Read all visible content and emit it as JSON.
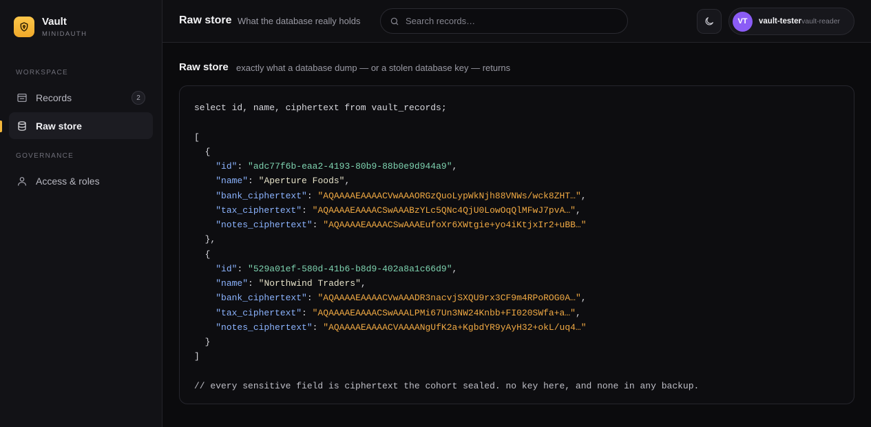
{
  "app": {
    "name": "Vault",
    "subtitle": "MINIDAUTH"
  },
  "sidebar": {
    "workspace_label": "WORKSPACE",
    "governance_label": "GOVERNANCE",
    "items": [
      {
        "label": "Records",
        "icon": "records-icon",
        "badge": "2"
      },
      {
        "label": "Raw store",
        "icon": "database-icon",
        "active": true
      },
      {
        "label": "Access & roles",
        "icon": "user-icon"
      }
    ]
  },
  "header": {
    "title": "Raw store",
    "subtitle": "What the database really holds",
    "search_placeholder": "Search records…",
    "user": {
      "initials": "VT",
      "name": "vault-tester",
      "role": "vault-reader"
    }
  },
  "content": {
    "title": "Raw store",
    "subtitle": "exactly what a database dump — or a stolen database key — returns",
    "query": "select id, name, ciphertext from vault_records;",
    "records": [
      {
        "id": "adc77f6b-eaa2-4193-80b9-88b0e9d944a9",
        "name": "Aperture Foods",
        "bank_ciphertext": "AQAAAAEAAAACVwAAAORGzQuoLypWkNjh88VNWs/wck8ZHT…",
        "tax_ciphertext": "AQAAAAEAAAACSwAAABzYLc5QNc4QjU0LowOqQlMFwJ7pvA…",
        "notes_ciphertext": "AQAAAAEAAAACSwAAAEufoXr6XWtgie+yo4iKtjxIr2+uBB…"
      },
      {
        "id": "529a01ef-580d-41b6-b8d9-402a8a1c66d9",
        "name": "Northwind Traders",
        "bank_ciphertext": "AQAAAAEAAAACVwAAADR3nacvjSXQU9rx3CF9m4RPoROG0A…",
        "tax_ciphertext": "AQAAAAEAAAACSwAAALPMi67Un3NW24Knbb+FI020SWfa+a…",
        "notes_ciphertext": "AQAAAAEAAAACVAAAANgUfK2a+KgbdYR9yAyH32+okL/uq4…"
      }
    ],
    "footer_comment": "// every sensitive field is ciphertext the cohort sealed. no key here, and none in any backup."
  },
  "colors": {
    "accent": "#f4b73b",
    "avatar": "#8b5cf6",
    "string_cipher": "#f0a943",
    "string_id": "#7ed3b0",
    "json_key": "#8cb4ff"
  }
}
